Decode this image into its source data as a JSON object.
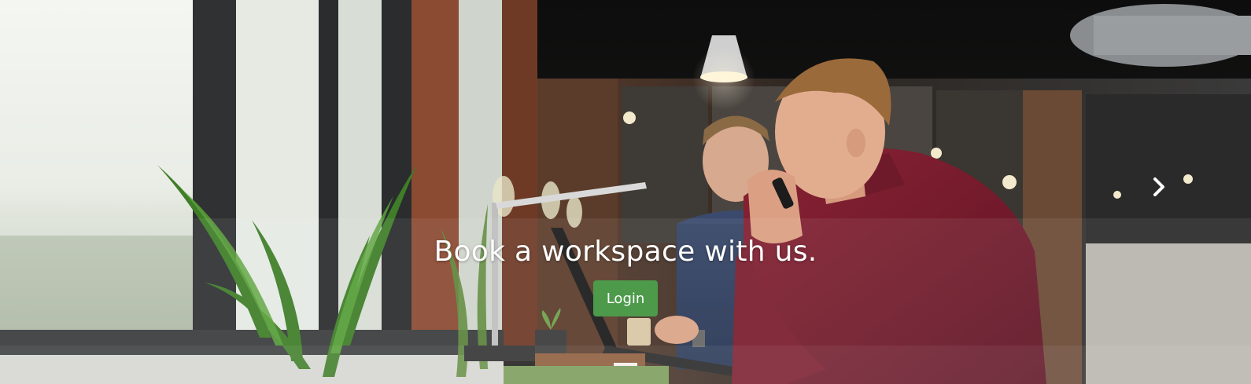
{
  "hero": {
    "headline": "Book a workspace with us.",
    "login_label": "Login",
    "button_color": "#4d9a4b",
    "next_icon": "chevron-right-icon",
    "slides": [
      {
        "active": true
      }
    ]
  }
}
